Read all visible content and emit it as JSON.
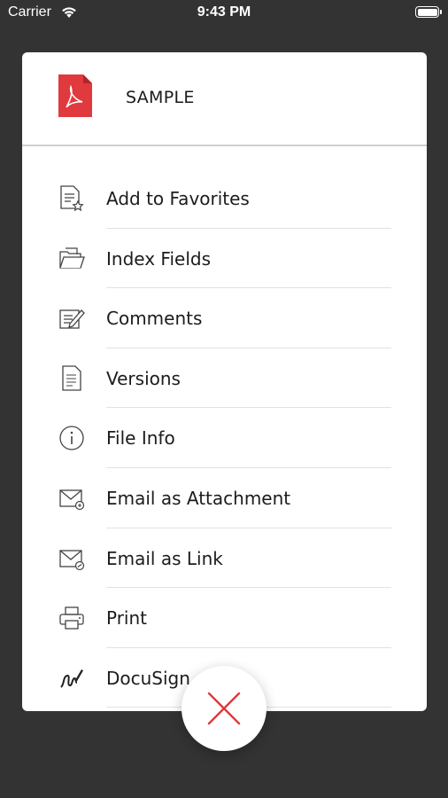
{
  "status_bar": {
    "carrier": "Carrier",
    "time": "9:43 PM"
  },
  "document": {
    "title": "SAMPLE",
    "icon": "pdf-file-icon"
  },
  "menu": [
    {
      "label": "Add to Favorites",
      "icon": "favorite-document-icon"
    },
    {
      "label": "Index Fields",
      "icon": "folder-open-icon"
    },
    {
      "label": "Comments",
      "icon": "comment-edit-icon"
    },
    {
      "label": "Versions",
      "icon": "versions-document-icon"
    },
    {
      "label": "File Info",
      "icon": "info-icon"
    },
    {
      "label": "Email as Attachment",
      "icon": "email-attachment-icon"
    },
    {
      "label": "Email as Link",
      "icon": "email-link-icon"
    },
    {
      "label": "Print",
      "icon": "print-icon"
    },
    {
      "label": "DocuSign",
      "icon": "docusign-icon"
    }
  ],
  "close": {
    "icon": "close-icon"
  },
  "colors": {
    "accent": "#e0393e",
    "overlay": "#333333"
  }
}
